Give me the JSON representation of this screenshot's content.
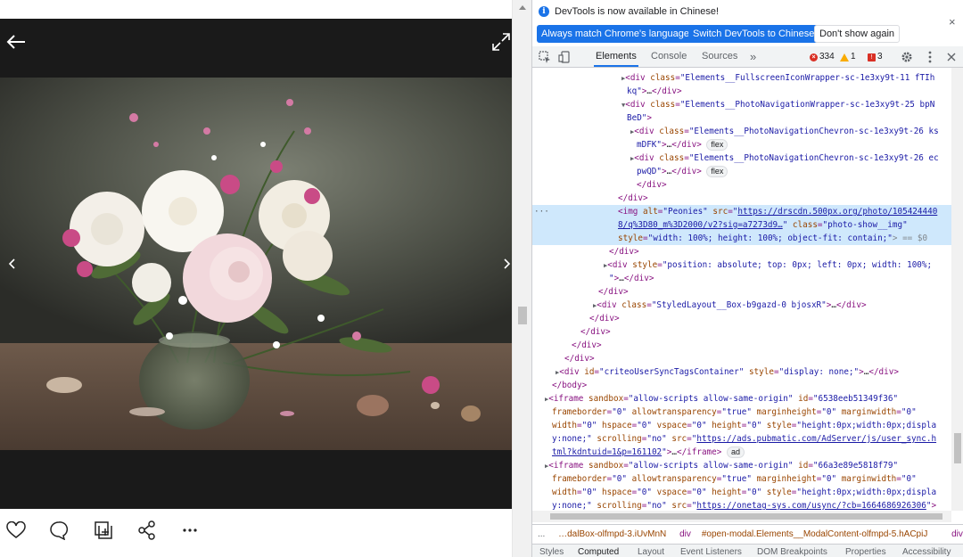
{
  "viewer": {
    "photo_alt": "Peonies"
  },
  "devtools": {
    "infobar": {
      "message": "DevTools is now available in Chinese!",
      "btn_match": "Always match Chrome's language",
      "btn_switch": "Switch DevTools to Chinese",
      "btn_dontshow": "Don't show again",
      "close": "×"
    },
    "tabs": {
      "elements": "Elements",
      "console": "Console",
      "sources": "Sources",
      "more": "»"
    },
    "counts": {
      "errors": "334",
      "warnings": "1",
      "issues": "3"
    },
    "breadcrumb": {
      "ellipsis": "...",
      "item1_tag": "…dalBox-olfmpd-3.iUvMnN",
      "item2_tag": "div",
      "item2_rest": "#open-modal.Elements__ModalContent-olfmpd-5.hACpiJ",
      "item3_tag": "div"
    },
    "bottom_tabs": [
      "Styles",
      "Computed",
      "Layout",
      "Event Listeners",
      "DOM Breakpoints",
      "Properties",
      "Accessibility"
    ]
  },
  "colors": {
    "accent": "#1a73e8",
    "selected_row": "#cfe8fc",
    "tag": "#881280",
    "attr_name": "#994500",
    "attr_value": "#1a1aa6"
  }
}
